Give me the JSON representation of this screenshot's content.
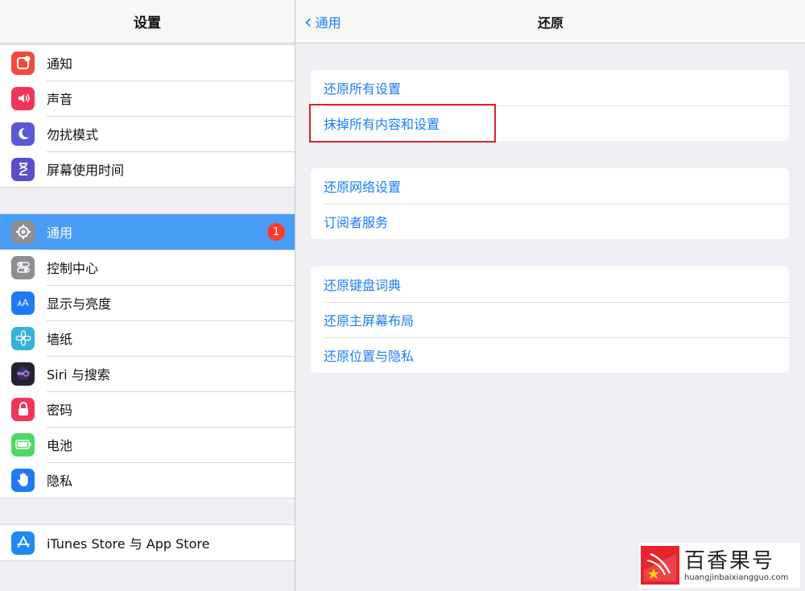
{
  "sidebar": {
    "title": "设置",
    "groups": [
      {
        "items": [
          {
            "label": "通知",
            "icon": "notifications-icon",
            "color": "#f24a3d"
          },
          {
            "label": "声音",
            "icon": "sounds-icon",
            "color": "#f0355a"
          },
          {
            "label": "勿扰模式",
            "icon": "moon-icon",
            "color": "#5b58d6"
          },
          {
            "label": "屏幕使用时间",
            "icon": "hourglass-icon",
            "color": "#5b4fc9"
          }
        ]
      },
      {
        "items": [
          {
            "label": "通用",
            "icon": "gear-icon",
            "color": "#8e8e93",
            "badge": "1",
            "selected": true
          },
          {
            "label": "控制中心",
            "icon": "toggles-icon",
            "color": "#8e8e93"
          },
          {
            "label": "显示与亮度",
            "icon": "display-icon",
            "color": "#1d7af2"
          },
          {
            "label": "墙纸",
            "icon": "flower-icon",
            "color": "#36b2d8"
          },
          {
            "label": "Siri 与搜索",
            "icon": "siri-icon",
            "color": "#222233"
          },
          {
            "label": "密码",
            "icon": "lock-icon",
            "color": "#f0355a"
          },
          {
            "label": "电池",
            "icon": "battery-icon",
            "color": "#4cd964"
          },
          {
            "label": "隐私",
            "icon": "hand-icon",
            "color": "#1d7af2"
          }
        ]
      },
      {
        "items": [
          {
            "label": "iTunes Store 与 App Store",
            "icon": "app-store-icon",
            "color": "#1d8af2"
          }
        ]
      }
    ]
  },
  "main": {
    "back_label": "通用",
    "title": "还原",
    "cards": [
      [
        "还原所有设置",
        "抹掉所有内容和设置"
      ],
      [
        "还原网络设置",
        "订阅者服务"
      ],
      [
        "还原键盘词典",
        "还原主屏幕布局",
        "还原位置与隐私"
      ]
    ],
    "highlighted": "抹掉所有内容和设置"
  },
  "watermark": {
    "title": "百香果号",
    "url": "huangjinbaixiangguo.com"
  }
}
